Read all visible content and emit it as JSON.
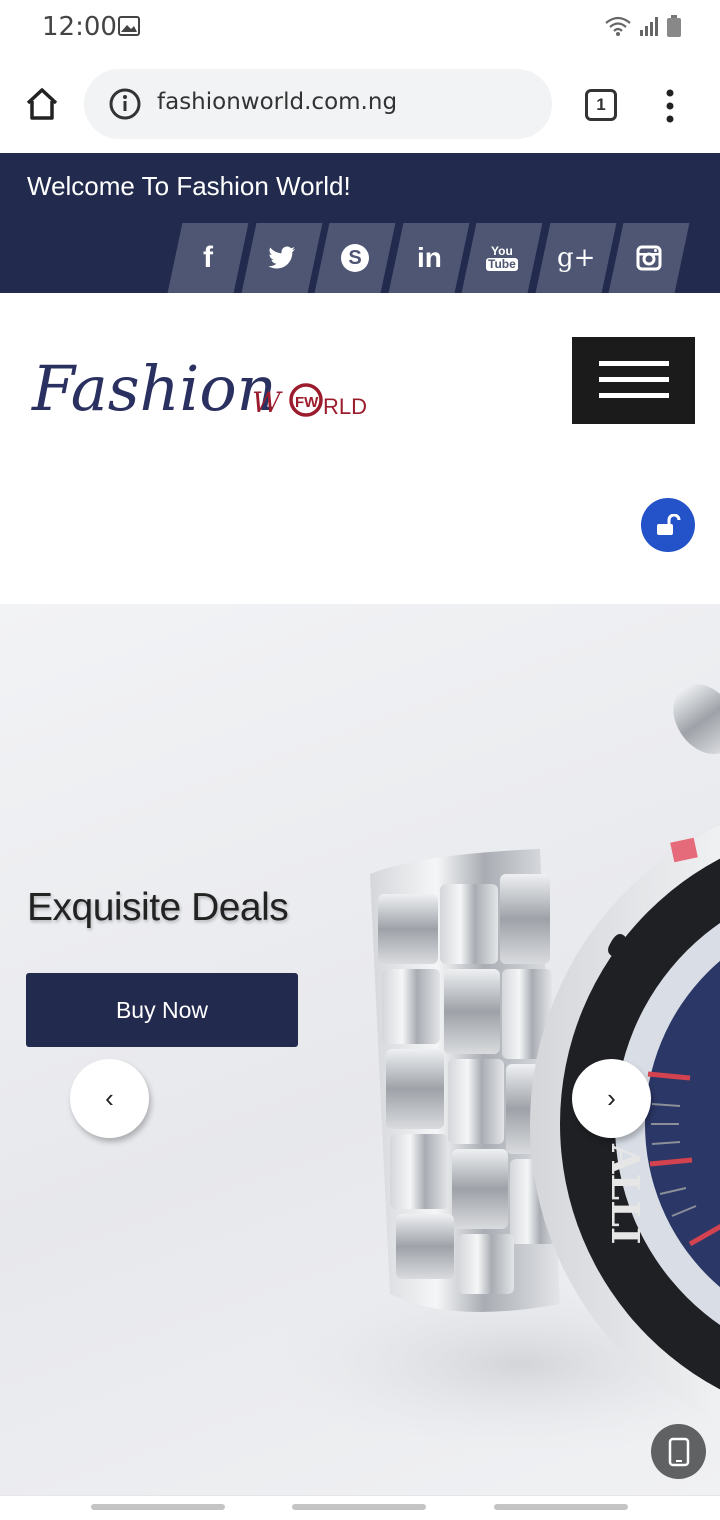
{
  "status_bar": {
    "time": "12:00",
    "icons": [
      "image-icon",
      "wifi-icon",
      "signal-icon",
      "battery-icon"
    ]
  },
  "browser": {
    "url": "fashionworld.com.ng",
    "tab_count": "1",
    "icons": [
      "home-icon",
      "info-icon",
      "tabs-icon",
      "more-vert-icon"
    ]
  },
  "header": {
    "welcome": "Welcome To Fashion World!",
    "social": [
      {
        "name": "facebook-icon",
        "glyph": "f"
      },
      {
        "name": "twitter-icon",
        "glyph": ""
      },
      {
        "name": "skype-icon",
        "glyph": "S"
      },
      {
        "name": "linkedin-icon",
        "glyph": "in"
      },
      {
        "name": "youtube-icon",
        "glyph_top": "You",
        "glyph_bottom": "Tube"
      },
      {
        "name": "google-plus-icon",
        "glyph": "g+"
      },
      {
        "name": "instagram-icon",
        "glyph": ""
      }
    ],
    "colors": {
      "bar": "#222b4e",
      "social_bg": "#4e5673"
    }
  },
  "branding": {
    "logo_script": "Fashion",
    "logo_w": "W",
    "logo_mark": "FW",
    "logo_rld": "RLD",
    "menu_icon": "hamburger-icon",
    "lock_icon": "unlock-icon",
    "colors": {
      "script": "#2a3160",
      "accent": "#9b1c2c",
      "lock": "#2453c9"
    }
  },
  "hero": {
    "title": "Exquisite Deals",
    "button": "Buy Now",
    "prev": "‹",
    "next": "›",
    "watch_bezel_text": "ALLI",
    "device_icon": "mobile-icon"
  }
}
